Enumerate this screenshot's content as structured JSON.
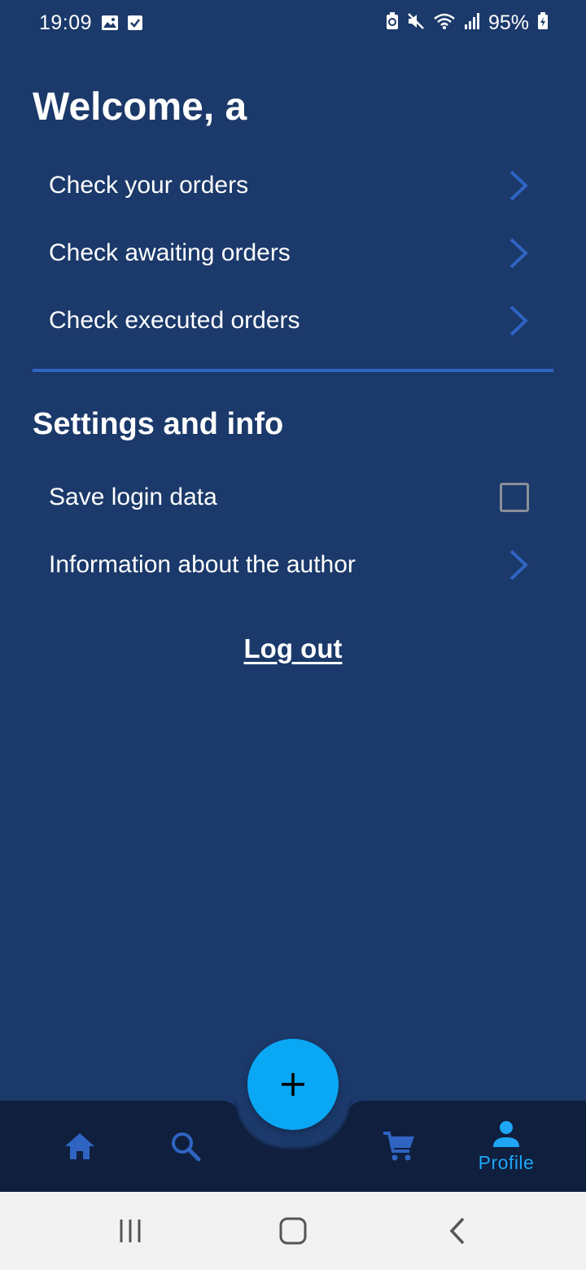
{
  "status_bar": {
    "time": "19:09",
    "battery_percent": "95%",
    "left_icons": [
      "image-icon",
      "checkbox-notification-icon"
    ],
    "right_icons": [
      "battery-saver-icon",
      "mute-icon",
      "wifi-icon",
      "signal-icon",
      "battery-charging-icon"
    ]
  },
  "header": {
    "welcome": "Welcome, a"
  },
  "orders_menu": {
    "items": [
      {
        "label": "Check your orders"
      },
      {
        "label": "Check awaiting orders"
      },
      {
        "label": "Check executed orders"
      }
    ]
  },
  "settings": {
    "title": "Settings and info",
    "save_login_label": "Save login data",
    "save_login_checked": false,
    "author_label": "Information about the author"
  },
  "logout_label": "Log out",
  "bottom_nav": {
    "items": [
      {
        "icon": "home-icon",
        "label": "",
        "active": false
      },
      {
        "icon": "search-icon",
        "label": "",
        "active": false
      },
      {
        "icon": "cart-icon",
        "label": "",
        "active": false
      },
      {
        "icon": "profile-icon",
        "label": "Profile",
        "active": true
      }
    ],
    "fab_icon": "plus-icon"
  },
  "colors": {
    "background": "#1b396a",
    "accent_blue": "#2f64c2",
    "fab": "#0aa7f4",
    "active_tab": "#1ea6f5",
    "bottom_nav": "#0f1f3d"
  }
}
